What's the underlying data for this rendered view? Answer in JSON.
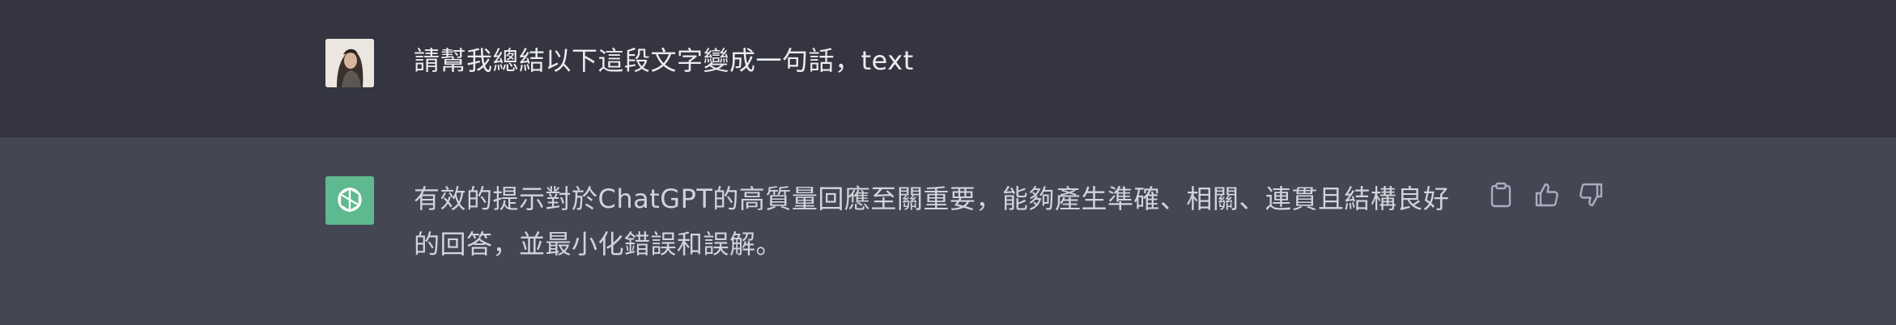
{
  "conversation": {
    "user_message": {
      "avatar_icon": "user-photo-avatar",
      "text": "請幫我總結以下這段文字變成一句話，text"
    },
    "assistant_message": {
      "avatar_icon": "openai-logo-icon",
      "avatar_color": "#5fb98f",
      "text": "有效的提示對於ChatGPT的高質量回應至關重要，能夠產生準確、相關、連貫且結構良好的回答，並最小化錯誤和誤解。",
      "actions": {
        "copy_icon": "clipboard-icon",
        "like_icon": "thumbs-up-icon",
        "dislike_icon": "thumbs-down-icon"
      }
    }
  },
  "colors": {
    "user_row_bg": "#343541",
    "assistant_row_bg": "#444654",
    "text_primary": "#ececf1",
    "text_secondary": "#d1d5db",
    "icon_color": "#acacbe"
  }
}
